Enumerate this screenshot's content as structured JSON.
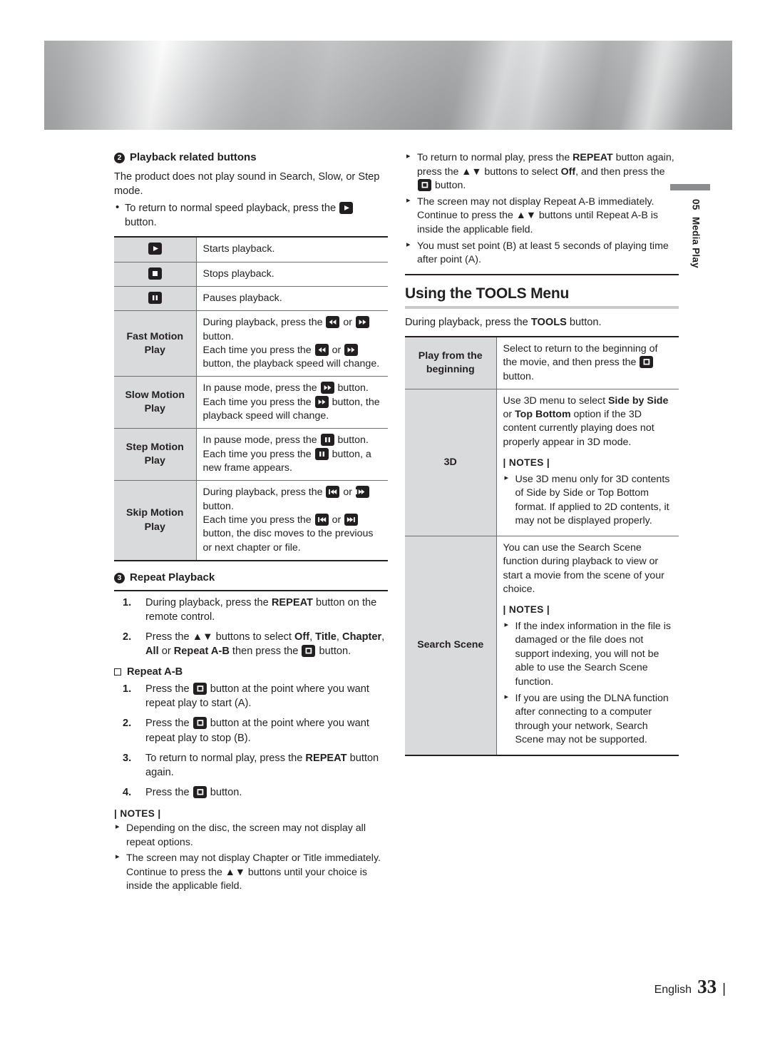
{
  "page": {
    "footer_language": "English",
    "footer_page": "33",
    "side_tab_number": "05",
    "side_tab_label": "Media Play"
  },
  "left_column": {
    "section2": {
      "marker": "2",
      "heading": "Playback related buttons",
      "intro": "The product does not play sound in Search, Slow, or Step mode.",
      "bullet_pre": "To return to normal speed playback, press the ",
      "bullet_post": " button."
    },
    "playback_table": {
      "rows": [
        {
          "key_icon": "play-icon",
          "key_text": "",
          "value": "Starts playback."
        },
        {
          "key_icon": "stop-icon",
          "key_text": "",
          "value": "Stops playback."
        },
        {
          "key_icon": "pause-icon",
          "key_text": "",
          "value": "Pauses playback."
        },
        {
          "key_icon": "",
          "key_text": "Fast Motion Play",
          "line1_a": "During playback, press the ",
          "line1_b": " or ",
          "line1_c": " button.",
          "line2_a": "Each time you press the ",
          "line2_b": " or ",
          "line2_c": " button, the playback speed will change."
        },
        {
          "key_icon": "",
          "key_text": "Slow Motion Play",
          "line1_a": "In pause mode, press the ",
          "line1_c": " button.",
          "line2_a": "Each time you press the ",
          "line2_c": " button, the playback speed will change."
        },
        {
          "key_icon": "",
          "key_text": "Step Motion Play",
          "line1_a": "In pause mode, press the ",
          "line1_c": " button.",
          "line2_a": "Each time you press the ",
          "line2_c": " button, a new frame appears."
        },
        {
          "key_icon": "",
          "key_text": "Skip Motion Play",
          "line1_a": "During playback, press the ",
          "line1_b": " or ",
          "line1_c": " button.",
          "line2_a": "Each time you press the ",
          "line2_b": " or ",
          "line2_c": " button, the disc moves to the previous or next chapter or file."
        }
      ]
    },
    "section3": {
      "marker": "3",
      "heading": "Repeat Playback",
      "step1_a": "During playback, press the ",
      "step1_b": "REPEAT",
      "step1_c": " button on the remote control.",
      "step2_a": "Press the ",
      "step2_arrows": "▲▼",
      "step2_b": " buttons to select ",
      "step2_off": "Off",
      "step2_sep1": ", ",
      "step2_title": "Title",
      "step2_sep2": ", ",
      "step2_chapter": "Chapter",
      "step2_sep3": ", ",
      "step2_all": "All",
      "step2_or": " or ",
      "step2_ab": "Repeat A-B",
      "step2_then": " then press the ",
      "step2_end": " button.",
      "sub_heading": "Repeat A-B",
      "ab_step1_a": "Press the ",
      "ab_step1_b": " button at the point where you want repeat play to start (A).",
      "ab_step2_a": "Press the ",
      "ab_step2_b": " button at the point where you want repeat play to stop (B).",
      "ab_step3_a": "To return to normal play, press the ",
      "ab_step3_bold": "REPEAT",
      "ab_step3_b": " button again.",
      "ab_step4_a": "Press the ",
      "ab_step4_b": " button."
    },
    "notes": {
      "title": "| NOTES |",
      "items": [
        "Depending on the disc, the screen may not display all repeat options.",
        "The screen may not display Chapter or Title immediately. Continue to press the ▲▼ buttons until your choice is inside the applicable field."
      ]
    }
  },
  "right_column": {
    "top_notes": {
      "n1_a": "To return to normal play, press the ",
      "n1_repeat": "REPEAT",
      "n1_b": " button again, press the ▲▼ buttons to select ",
      "n1_off": "Off",
      "n1_c": ", and then press the ",
      "n1_d": " button.",
      "n2": "The screen may not display Repeat A-B immediately. Continue to press the ▲▼ buttons until Repeat A-B is inside the applicable field.",
      "n3": "You must set point (B) at least 5 seconds of  playing time after point (A)."
    },
    "section_heading": "Using the TOOLS Menu",
    "section_intro_a": "During playback, press the ",
    "section_intro_bold": "TOOLS",
    "section_intro_b": " button.",
    "tools_table": {
      "rows": [
        {
          "key": "Play from the beginning",
          "text_a": "Select to return to the beginning of the movie, and then press the ",
          "text_b": " button."
        },
        {
          "key": "3D",
          "text_a": "Use 3D menu to select ",
          "bold1": "Side by Side",
          "text_b": " or ",
          "bold2": "Top Bottom",
          "text_c": " option if the 3D content currently playing does not properly appear in 3D mode.",
          "notes_title": "| NOTES |",
          "notes": [
            "Use 3D menu only for 3D contents of Side by Side or Top Bottom format. If applied to 2D contents, it may not be displayed properly."
          ]
        },
        {
          "key": "Search Scene",
          "text_a": "You can use the Search Scene function during playback to view or start a movie from the scene of your choice.",
          "notes_title": "| NOTES |",
          "notes": [
            "If the index information in the file is damaged or the file does not support indexing, you will not be able to use the Search Scene function.",
            "If you are using the DLNA function after connecting to a computer through your network, Search Scene may not be supported."
          ]
        }
      ]
    }
  }
}
